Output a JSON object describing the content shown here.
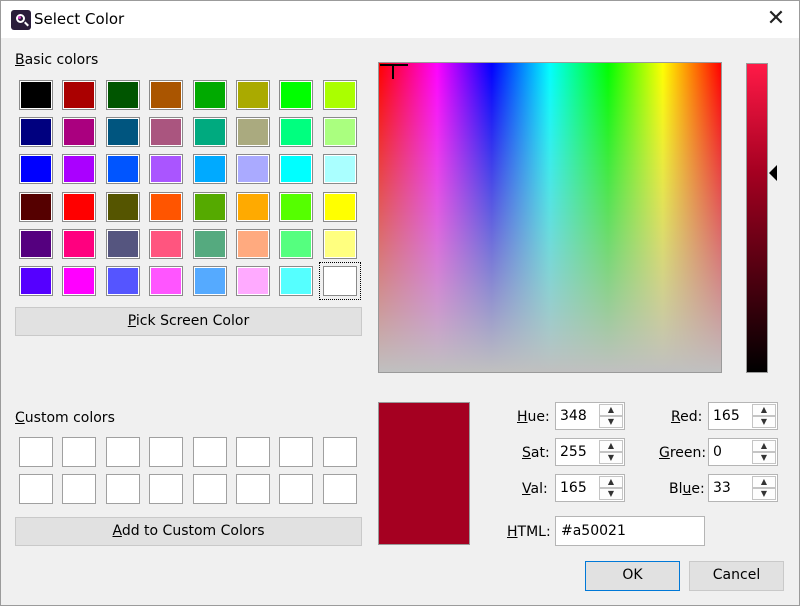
{
  "window": {
    "title": "Select Color",
    "close_glyph": "✕",
    "app_icon": "color-picker-icon"
  },
  "basic_colors": {
    "label": "Basic colors",
    "mnemonic": "B",
    "rows": [
      [
        "#000000",
        "#aa0000",
        "#005500",
        "#aa5500",
        "#00aa00",
        "#aaaa00",
        "#00ff00",
        "#aaff00"
      ],
      [
        "#00007f",
        "#aa007f",
        "#00557f",
        "#aa557f",
        "#00aa7f",
        "#aaaa7f",
        "#00ff7f",
        "#aaff7f"
      ],
      [
        "#0000ff",
        "#aa00ff",
        "#0055ff",
        "#aa55ff",
        "#00aaff",
        "#aaaaff",
        "#00ffff",
        "#aaffff"
      ],
      [
        "#550000",
        "#ff0000",
        "#555500",
        "#ff5500",
        "#55aa00",
        "#ffaa00",
        "#55ff00",
        "#ffff00"
      ],
      [
        "#55007f",
        "#ff007f",
        "#55557f",
        "#ff557f",
        "#55aa7f",
        "#ffaa7f",
        "#55ff7f",
        "#ffff7f"
      ],
      [
        "#5500ff",
        "#ff00ff",
        "#5555ff",
        "#ff55ff",
        "#55aaff",
        "#ffaaff",
        "#55ffff",
        "#ffffff"
      ]
    ],
    "selected": "#ffffff"
  },
  "pick_screen_button": {
    "label": "Pick Screen Color",
    "mnemonic": "P"
  },
  "custom_colors": {
    "label": "Custom colors",
    "mnemonic": "C",
    "count": 16
  },
  "add_custom_button": {
    "label": "Add to Custom Colors",
    "mnemonic": "A"
  },
  "current_color": "#a50021",
  "fields": {
    "hue": {
      "label": "Hue:",
      "mnemonic": "H",
      "value": "348"
    },
    "sat": {
      "label": "Sat:",
      "mnemonic": "S",
      "value": "255"
    },
    "val": {
      "label": "Val:",
      "mnemonic": "V",
      "value": "165"
    },
    "red": {
      "label": "Red:",
      "mnemonic": "R",
      "value": "165"
    },
    "green": {
      "label": "Green:",
      "mnemonic": "G",
      "value": "0"
    },
    "blue": {
      "label": "Blue:",
      "mnemonic": "u",
      "value": "33"
    },
    "html": {
      "label": "HTML:",
      "mnemonic": "H",
      "value": "#a50021"
    }
  },
  "buttons": {
    "ok": "OK",
    "cancel": "Cancel"
  },
  "colors": {
    "accent": "#0078d7",
    "background": "#f0f0f0"
  }
}
